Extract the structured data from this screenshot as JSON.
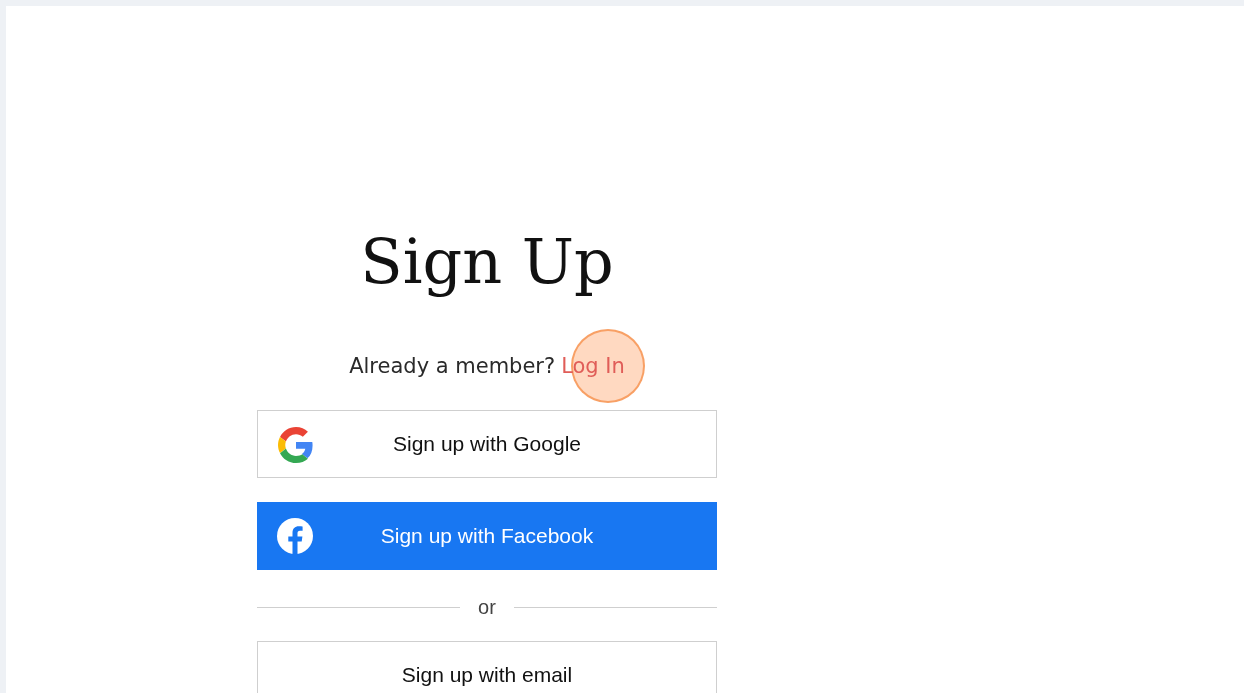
{
  "title": "Sign Up",
  "login_prompt": {
    "text": "Already a member?",
    "link": "Log In"
  },
  "buttons": [
    {
      "kind": "google",
      "label": "Sign up with Google"
    },
    {
      "kind": "facebook",
      "label": "Sign up with Facebook"
    },
    {
      "kind": "divider",
      "label": "or"
    },
    {
      "kind": "email",
      "label": "Sign up with email"
    }
  ]
}
